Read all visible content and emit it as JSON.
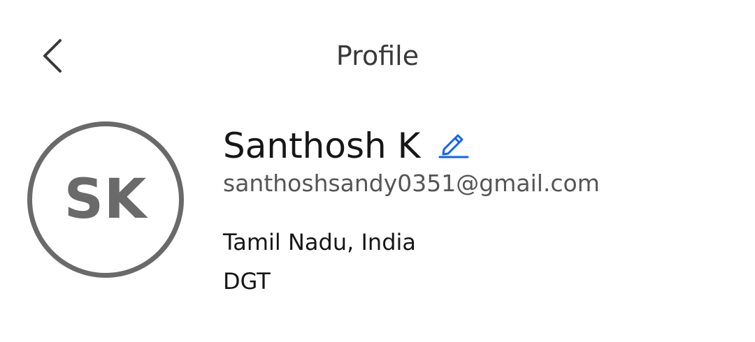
{
  "header": {
    "back_icon": "chevron-left-icon",
    "title": "Profile"
  },
  "profile": {
    "initials": "SK",
    "name": "Santhosh K",
    "edit_icon": "pencil-edit-icon",
    "email": "santhoshsandy0351@gmail.com",
    "location": "Tamil Nadu, India",
    "organization": "DGT"
  },
  "colors": {
    "title_text": "#393939",
    "primary_text": "#161616",
    "secondary_text": "#555555",
    "avatar_gray": "#6a6a6a",
    "accent_blue": "#0f62fe"
  }
}
